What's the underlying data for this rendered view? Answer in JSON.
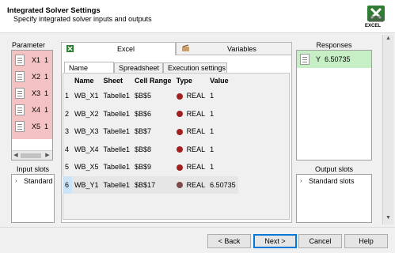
{
  "header": {
    "title": "Integrated Solver Settings",
    "subtitle": "Specify integrated solver inputs and outputs",
    "logo_text": "EXCEL"
  },
  "parameter": {
    "label": "Parameter",
    "items": [
      {
        "name": "X1",
        "value": "1"
      },
      {
        "name": "X2",
        "value": "1"
      },
      {
        "name": "X3",
        "value": "1"
      },
      {
        "name": "X4",
        "value": "1"
      },
      {
        "name": "X5",
        "value": "1"
      }
    ]
  },
  "input_slots": {
    "label": "Input slots",
    "tree_item": "Standard"
  },
  "tabs": {
    "excel": "Excel",
    "variables": "Variables"
  },
  "subtabs": {
    "name_manager": "Name Manager",
    "spreadsheet": "Spreadsheet",
    "execution_settings": "Execution settings"
  },
  "table": {
    "columns": [
      "Name",
      "Sheet",
      "Cell Range",
      "Type",
      "Value"
    ],
    "rows": [
      {
        "num": "1",
        "name": "WB_X1",
        "sheet": "Tabelle1",
        "range": "$B$5",
        "type": "REAL",
        "value": "1"
      },
      {
        "num": "2",
        "name": "WB_X2",
        "sheet": "Tabelle1",
        "range": "$B$6",
        "type": "REAL",
        "value": "1"
      },
      {
        "num": "3",
        "name": "WB_X3",
        "sheet": "Tabelle1",
        "range": "$B$7",
        "type": "REAL",
        "value": "1"
      },
      {
        "num": "4",
        "name": "WB_X4",
        "sheet": "Tabelle1",
        "range": "$B$8",
        "type": "REAL",
        "value": "1"
      },
      {
        "num": "5",
        "name": "WB_X5",
        "sheet": "Tabelle1",
        "range": "$B$9",
        "type": "REAL",
        "value": "1"
      },
      {
        "num": "6",
        "name": "WB_Y1",
        "sheet": "Tabelle1",
        "range": "$B$17",
        "type": "REAL",
        "value": "6.50735"
      }
    ]
  },
  "responses": {
    "label": "Responses",
    "items": [
      {
        "name": "Y",
        "value": "6.50735"
      }
    ]
  },
  "output_slots": {
    "label": "Output slots",
    "tree_item": "Standard slots"
  },
  "buttons": {
    "back": "< Back",
    "next": "Next >",
    "cancel": "Cancel",
    "help": "Help"
  },
  "colors": {
    "param_bg": "#f4c2c2",
    "response_bg": "#c6efc6",
    "dot": "#a32020",
    "accent": "#0078d7"
  }
}
